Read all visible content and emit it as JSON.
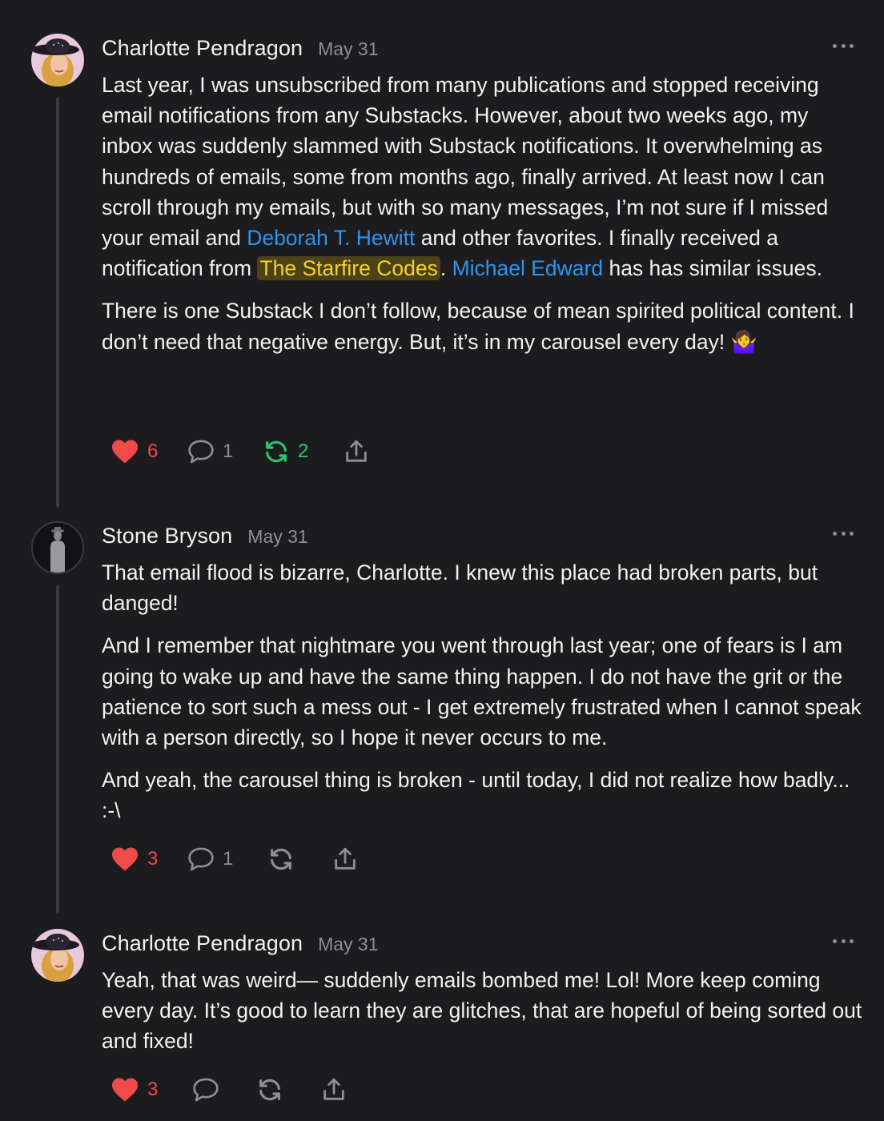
{
  "colors": {
    "background": "#1c1c1e",
    "mention": "#2f93f0",
    "highlight": "#f7d02c",
    "like": "#f04a4a",
    "restack": "#2ec46b",
    "muted": "#8e8e93"
  },
  "comments": [
    {
      "author": "Charlotte Pendragon",
      "date": "May 31",
      "avatar_icon": "woman-in-hat-avatar",
      "paragraphs": [
        {
          "part1": "Last year, I was unsubscribed from many publications and stopped receiving email notifications from any Substacks. However, about two weeks ago, my inbox was suddenly slammed with Substack notifications. It overwhelming as hundreds of emails, some from months ago, finally arrived. At least now I can scroll through my emails, but with so many messages, I’m not sure if I missed your email and ",
          "mention1": "Deborah T. Hewitt",
          "part2": " and other favorites. I finally received a notification from ",
          "highlight": "The Starfire Codes",
          "part3": ". ",
          "mention2": "Michael Edward",
          "part4": " has has similar issues."
        },
        {
          "text": "There is one Substack I don’t follow, because of mean spirited political content. I don’t need that negative energy. But, it’s in my carousel every day! 🤷‍♀️"
        }
      ],
      "likes": "6",
      "replies": "1",
      "restacks": "2",
      "restacked": true
    },
    {
      "author": "Stone Bryson",
      "date": "May 31",
      "avatar_icon": "silhouette-avatar",
      "paragraphs": [
        {
          "text": "That email flood is bizarre, Charlotte. I knew this place had broken parts, but danged!"
        },
        {
          "text": "And I remember that nightmare you went through last year; one of fears is I am going to wake up and have the same thing happen. I do not have the grit or the patience to sort such a mess out - I get extremely frustrated when I cannot speak with a person directly, so I hope it never occurs to me."
        },
        {
          "text": "And yeah, the carousel thing is broken - until today, I did not realize how badly... :-\\"
        }
      ],
      "likes": "3",
      "replies": "1",
      "restacks": "",
      "restacked": false
    },
    {
      "author": "Charlotte Pendragon",
      "date": "May 31",
      "avatar_icon": "woman-in-hat-avatar",
      "paragraphs": [
        {
          "text": "Yeah, that was weird— suddenly emails bombed me! Lol! More keep coming every day. It’s good to learn they are glitches, that are hopeful of being sorted out and fixed!"
        }
      ],
      "likes": "3",
      "replies": "",
      "restacks": "",
      "restacked": false
    }
  ]
}
